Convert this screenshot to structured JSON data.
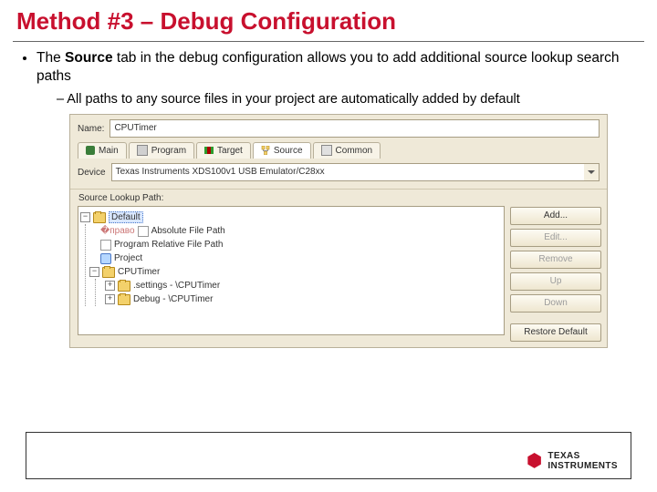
{
  "slide": {
    "title": "Method #3 – Debug Configuration",
    "bullet1_pre": "The ",
    "bullet1_bold": "Source",
    "bullet1_post": " tab in the debug configuration allows you to add additional source lookup search paths",
    "bullet2": "All paths to any source files in your project are automatically added by default"
  },
  "dialog": {
    "name_label": "Name:",
    "name_value": "CPUTimer",
    "tabs": {
      "main": "Main",
      "program": "Program",
      "target": "Target",
      "source": "Source",
      "common": "Common"
    },
    "device_label": "Device",
    "device_value": "Texas Instruments XDS100v1 USB Emulator/C28xx",
    "lookup_label": "Source Lookup Path:",
    "tree": {
      "default": "Default",
      "abs": "Absolute File Path",
      "rel": "Program Relative File Path",
      "project": "Project",
      "cputimer": "CPUTimer",
      "settings": ".settings - \\CPUTimer",
      "debug": "Debug - \\CPUTimer"
    },
    "buttons": {
      "add": "Add...",
      "edit": "Edit...",
      "remove": "Remove",
      "up": "Up",
      "down": "Down",
      "restore": "Restore Default"
    }
  },
  "footer": {
    "brand1": "TEXAS",
    "brand2": "INSTRUMENTS"
  }
}
